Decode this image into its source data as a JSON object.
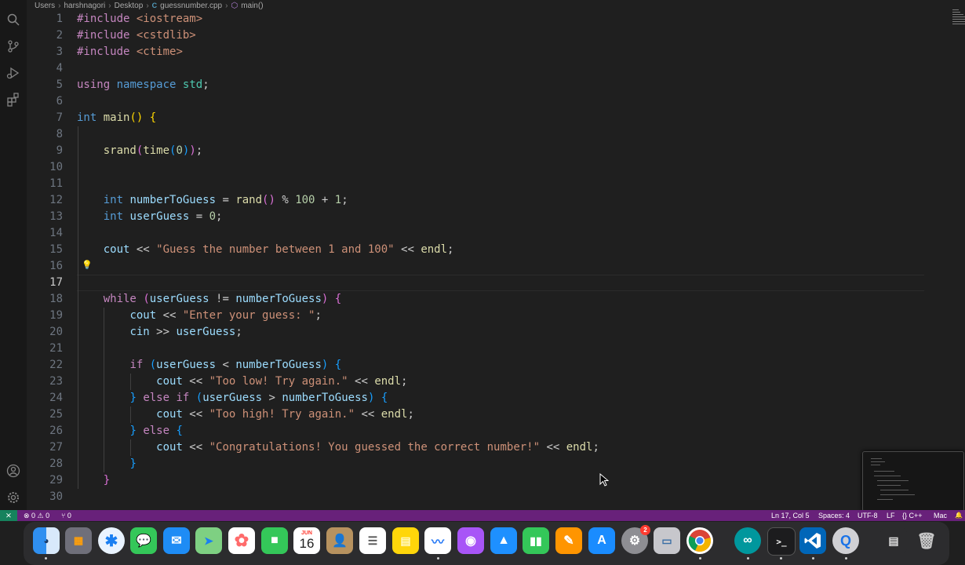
{
  "breadcrumb": {
    "parts": [
      "Users",
      "harshnagori",
      "Desktop",
      "guessnumber.cpp",
      "main()"
    ],
    "file_icon": "C",
    "separator": "›"
  },
  "editor": {
    "active_line": 17,
    "line_numbers": [
      "1",
      "2",
      "3",
      "4",
      "5",
      "6",
      "7",
      "8",
      "9",
      "10",
      "11",
      "12",
      "13",
      "14",
      "15",
      "16",
      "17",
      "18",
      "19",
      "20",
      "21",
      "22",
      "23",
      "24",
      "25",
      "26",
      "27",
      "28",
      "29",
      "30"
    ],
    "lines": [
      [
        {
          "t": "#include",
          "c": "pp"
        },
        {
          "t": " "
        },
        {
          "t": "<iostream>",
          "c": "inc"
        }
      ],
      [
        {
          "t": "#include",
          "c": "pp"
        },
        {
          "t": " "
        },
        {
          "t": "<cstdlib>",
          "c": "inc"
        }
      ],
      [
        {
          "t": "#include",
          "c": "pp"
        },
        {
          "t": " "
        },
        {
          "t": "<ctime>",
          "c": "inc"
        }
      ],
      [],
      [
        {
          "t": "using",
          "c": "kw2"
        },
        {
          "t": " "
        },
        {
          "t": "namespace",
          "c": "kw"
        },
        {
          "t": " "
        },
        {
          "t": "std",
          "c": "ns"
        },
        {
          "t": ";"
        }
      ],
      [],
      [
        {
          "t": "int",
          "c": "kw"
        },
        {
          "t": " "
        },
        {
          "t": "main",
          "c": "fn"
        },
        {
          "t": "()",
          "c": "b1"
        },
        {
          "t": " "
        },
        {
          "t": "{",
          "c": "b1"
        }
      ],
      [],
      [
        {
          "t": "    "
        },
        {
          "t": "srand",
          "c": "fn"
        },
        {
          "t": "(",
          "c": "b2"
        },
        {
          "t": "time",
          "c": "fn"
        },
        {
          "t": "(",
          "c": "b3"
        },
        {
          "t": "0",
          "c": "num"
        },
        {
          "t": ")",
          "c": "b3"
        },
        {
          "t": ")",
          "c": "b2"
        },
        {
          "t": ";"
        }
      ],
      [],
      [],
      [
        {
          "t": "    "
        },
        {
          "t": "int",
          "c": "kw"
        },
        {
          "t": " "
        },
        {
          "t": "numberToGuess",
          "c": "vr"
        },
        {
          "t": " = "
        },
        {
          "t": "rand",
          "c": "fn"
        },
        {
          "t": "()",
          "c": "b2"
        },
        {
          "t": " % "
        },
        {
          "t": "100",
          "c": "num"
        },
        {
          "t": " + "
        },
        {
          "t": "1",
          "c": "num"
        },
        {
          "t": ";"
        }
      ],
      [
        {
          "t": "    "
        },
        {
          "t": "int",
          "c": "kw"
        },
        {
          "t": " "
        },
        {
          "t": "userGuess",
          "c": "vr"
        },
        {
          "t": " = "
        },
        {
          "t": "0",
          "c": "num"
        },
        {
          "t": ";"
        }
      ],
      [],
      [
        {
          "t": "    "
        },
        {
          "t": "cout",
          "c": "vr"
        },
        {
          "t": " << "
        },
        {
          "t": "\"Guess the number between 1 and 100\"",
          "c": "str"
        },
        {
          "t": " << "
        },
        {
          "t": "endl",
          "c": "fn"
        },
        {
          "t": ";"
        }
      ],
      [],
      [],
      [
        {
          "t": "    "
        },
        {
          "t": "while",
          "c": "kw2"
        },
        {
          "t": " "
        },
        {
          "t": "(",
          "c": "b2"
        },
        {
          "t": "userGuess",
          "c": "vr"
        },
        {
          "t": " != "
        },
        {
          "t": "numberToGuess",
          "c": "vr"
        },
        {
          "t": ")",
          "c": "b2"
        },
        {
          "t": " "
        },
        {
          "t": "{",
          "c": "b2"
        }
      ],
      [
        {
          "t": "        "
        },
        {
          "t": "cout",
          "c": "vr"
        },
        {
          "t": " << "
        },
        {
          "t": "\"Enter your guess: \"",
          "c": "str"
        },
        {
          "t": ";"
        }
      ],
      [
        {
          "t": "        "
        },
        {
          "t": "cin",
          "c": "vr"
        },
        {
          "t": " >> "
        },
        {
          "t": "userGuess",
          "c": "vr"
        },
        {
          "t": ";"
        }
      ],
      [],
      [
        {
          "t": "        "
        },
        {
          "t": "if",
          "c": "kw2"
        },
        {
          "t": " "
        },
        {
          "t": "(",
          "c": "b3"
        },
        {
          "t": "userGuess",
          "c": "vr"
        },
        {
          "t": " < "
        },
        {
          "t": "numberToGuess",
          "c": "vr"
        },
        {
          "t": ")",
          "c": "b3"
        },
        {
          "t": " "
        },
        {
          "t": "{",
          "c": "b3"
        }
      ],
      [
        {
          "t": "            "
        },
        {
          "t": "cout",
          "c": "vr"
        },
        {
          "t": " << "
        },
        {
          "t": "\"Too low! Try again.\"",
          "c": "str"
        },
        {
          "t": " << "
        },
        {
          "t": "endl",
          "c": "fn"
        },
        {
          "t": ";"
        }
      ],
      [
        {
          "t": "        "
        },
        {
          "t": "}",
          "c": "b3"
        },
        {
          "t": " "
        },
        {
          "t": "else",
          "c": "kw2"
        },
        {
          "t": " "
        },
        {
          "t": "if",
          "c": "kw2"
        },
        {
          "t": " "
        },
        {
          "t": "(",
          "c": "b3"
        },
        {
          "t": "userGuess",
          "c": "vr"
        },
        {
          "t": " > "
        },
        {
          "t": "numberToGuess",
          "c": "vr"
        },
        {
          "t": ")",
          "c": "b3"
        },
        {
          "t": " "
        },
        {
          "t": "{",
          "c": "b3"
        }
      ],
      [
        {
          "t": "            "
        },
        {
          "t": "cout",
          "c": "vr"
        },
        {
          "t": " << "
        },
        {
          "t": "\"Too high! Try again.\"",
          "c": "str"
        },
        {
          "t": " << "
        },
        {
          "t": "endl",
          "c": "fn"
        },
        {
          "t": ";"
        }
      ],
      [
        {
          "t": "        "
        },
        {
          "t": "}",
          "c": "b3"
        },
        {
          "t": " "
        },
        {
          "t": "else",
          "c": "kw2"
        },
        {
          "t": " "
        },
        {
          "t": "{",
          "c": "b3"
        }
      ],
      [
        {
          "t": "            "
        },
        {
          "t": "cout",
          "c": "vr"
        },
        {
          "t": " << "
        },
        {
          "t": "\"Congratulations! You guessed the correct number!\"",
          "c": "str"
        },
        {
          "t": " << "
        },
        {
          "t": "endl",
          "c": "fn"
        },
        {
          "t": ";"
        }
      ],
      [
        {
          "t": "        "
        },
        {
          "t": "}",
          "c": "b3"
        }
      ],
      [
        {
          "t": "    "
        },
        {
          "t": "}",
          "c": "b2"
        }
      ],
      []
    ]
  },
  "status_bar": {
    "remote_icon": "⨯",
    "problems": "⊗ 0 ⚠ 0",
    "ports": "⑂ 0",
    "cursor_position": "Ln 17, Col 5",
    "spaces": "Spaces: 4",
    "encoding": "UTF-8",
    "eol": "LF",
    "language": "{} C++",
    "platform": "Mac",
    "bell": "🔔"
  },
  "dock": {
    "calendar_month": "JUN",
    "calendar_day": "16",
    "settings_badge": "2",
    "terminal_glyph": ">_",
    "apps": [
      "finder",
      "launchpad",
      "safari",
      "messages",
      "mail",
      "maps",
      "photos",
      "facetime",
      "calendar",
      "contacts",
      "reminders",
      "notes",
      "freeform",
      "podcasts",
      "keynote",
      "numbers",
      "pages",
      "app-store",
      "system-settings",
      "preview",
      "chrome",
      "arduino",
      "terminal",
      "vscode",
      "quicktime",
      "downloads",
      "trash"
    ]
  },
  "colors": {
    "status_bar": "#68217a",
    "remote": "#16825d",
    "editor_bg": "#1f1f1f"
  }
}
